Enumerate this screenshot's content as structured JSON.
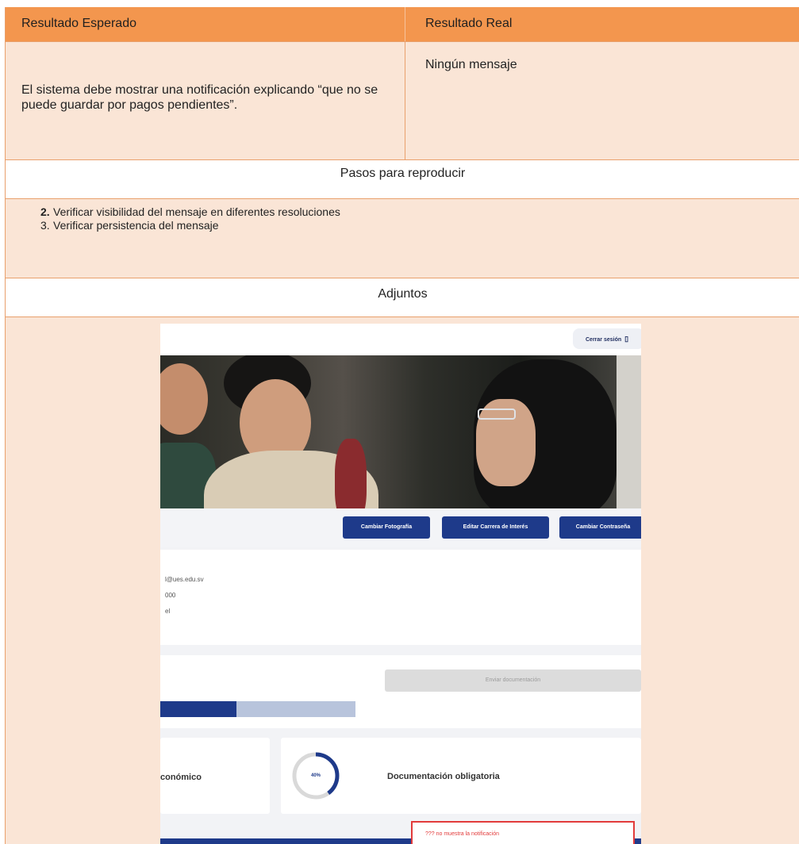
{
  "table": {
    "header": {
      "expected_label": "Resultado Esperado",
      "real_label": "Resultado Real"
    },
    "expected_result": "El sistema debe mostrar una notificación explicando “que no se puede guardar por pagos pendientes”.",
    "real_result": "Ningún mensaje",
    "steps_title": "Pasos para reproducir",
    "steps": [
      {
        "num": "2.",
        "text": "Verificar visibilidad del mensaje en diferentes resoluciones"
      },
      {
        "num": "3.",
        "text": "Verificar persistencia del mensaje"
      }
    ],
    "attachments_title": "Adjuntos"
  },
  "screenshot": {
    "logout_label": "Cerrar sesión",
    "buttons": {
      "change_photo": "Cambiar Fotografía",
      "edit_career": "Editar Carrera de Interés",
      "change_password": "Cambiar Contraseña"
    },
    "info_lines": [
      "l@ues.edu.sv",
      "000",
      "el"
    ],
    "send_docs_label": "Enviar documentación",
    "progress_fraction": 0.39,
    "card_economic_label": "conómico",
    "ring_percent_label": "40%",
    "ring_fraction": 0.4,
    "card_docs_title": "Documentación obligatoria",
    "annotation": "??? no muestra la notificación",
    "colors": {
      "primary": "#1e3a8a",
      "annotation": "#e23b3b"
    }
  }
}
